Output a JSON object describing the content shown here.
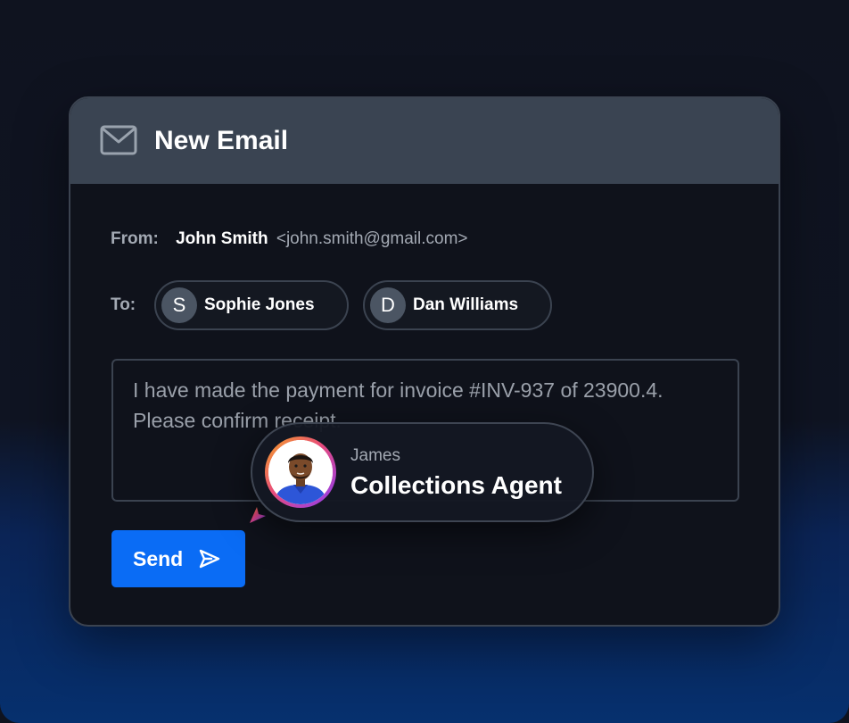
{
  "window": {
    "title": "New Email",
    "title_icon": "mail-icon"
  },
  "from": {
    "label": "From:",
    "name": "John Smith",
    "email": "<john.smith@gmail.com>"
  },
  "to": {
    "label": "To:",
    "recipients": [
      {
        "initial": "S",
        "name": "Sophie Jones"
      },
      {
        "initial": "D",
        "name": "Dan Williams"
      }
    ]
  },
  "message": {
    "text": "I have made the payment for invoice #INV-937 of 23900.4. Please confirm receipt."
  },
  "send": {
    "label": "Send",
    "icon": "send-icon"
  },
  "agent": {
    "name": "James",
    "role": "Collections Agent"
  },
  "colors": {
    "accent": "#0a6cf5",
    "titlebar": "#3a4452",
    "background": "#0f121b"
  }
}
